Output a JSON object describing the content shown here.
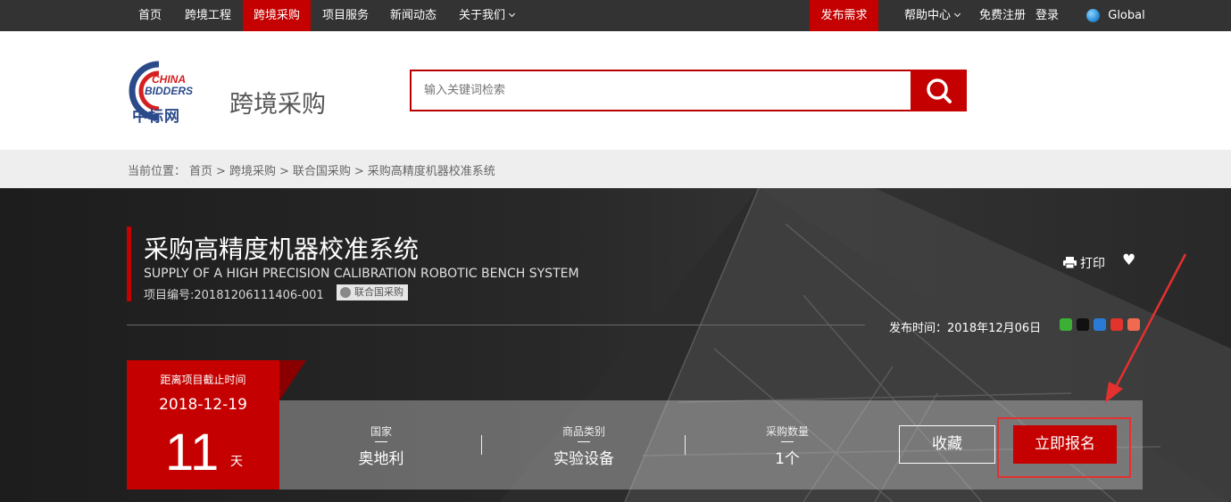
{
  "topnav": {
    "items": [
      "首页",
      "跨境工程",
      "跨境采购",
      "项目服务",
      "新闻动态",
      "关于我们"
    ],
    "publish": "发布需求",
    "help": "帮助中心",
    "register": "免费注册",
    "login": "登录",
    "global": "Global"
  },
  "header": {
    "logo_line1": "CHINA",
    "logo_line2": "BIDDERS",
    "logo_cn": "中标网",
    "site_title": "跨境采购",
    "search_placeholder": "输入关键词检索"
  },
  "breadcrumb": [
    "当前位置：",
    "首页",
    ">",
    "跨境采购",
    ">",
    "联合国采购",
    ">",
    "采购高精度机器校准系统"
  ],
  "project": {
    "title": "采购高精度机器校准系统",
    "subtitle": "SUPPLY OF A HIGH PRECISION CALIBRATION ROBOTIC BENCH SYSTEM",
    "number": "项目编号:20181206111406-001",
    "tag": "联合国采购",
    "print": "打印",
    "publish_time": "发布时间：2018年12月06日"
  },
  "deadline": {
    "label": "距离项目截止时间",
    "date": "2018-12-19",
    "days": "11",
    "unit": "天"
  },
  "info": {
    "country_key": "国家",
    "country_val": "奥地利",
    "category_key": "商品类别",
    "category_val": "实验设备",
    "qty_key": "采购数量",
    "qty_val": "1个"
  },
  "buttons": {
    "favorite": "收藏",
    "signup": "立即报名"
  },
  "colors": {
    "brand_red": "#c40000",
    "nav_bg": "#333333",
    "annotation_red": "#e53030"
  }
}
